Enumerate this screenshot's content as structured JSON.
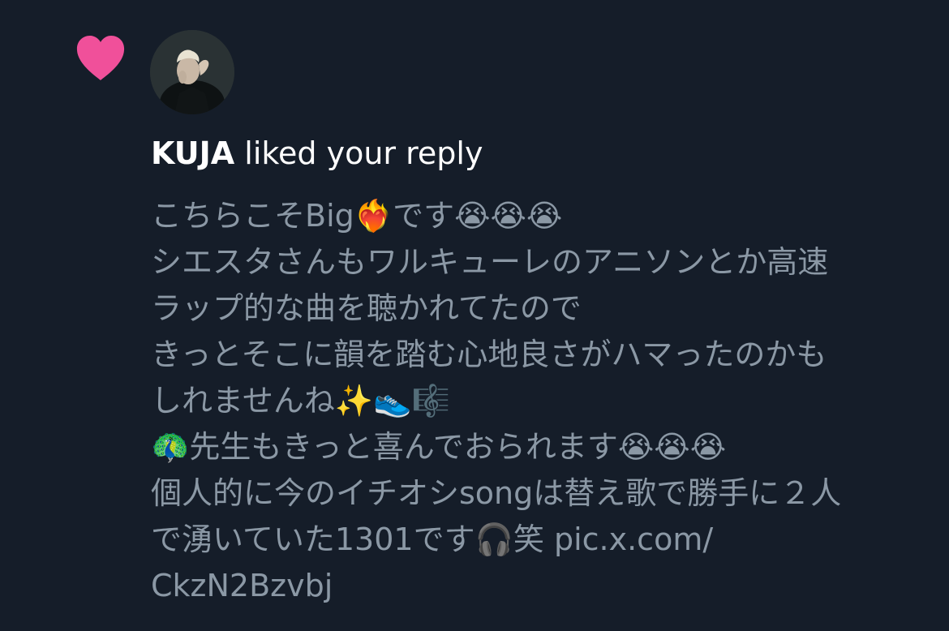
{
  "notification": {
    "username": "KUJA",
    "action_text": " liked your reply",
    "reply_lines": [
      "こちらこそBig❤️‍🔥です😭😭😭",
      "シエスタさんもワルキューレのアニソンとか高速",
      "ラップ的な曲を聴かれてたので",
      "きっとそこに韻を踏む心地良さがハマったのかも",
      "しれませんね✨👟🎼",
      "🦚先生もきっと喜んでおられます😭😭😭",
      "個人的に今のイチオシsongは替え歌で勝手に２人",
      "で湧いていた1301です🎧笑 pic.x.com/",
      "CkzN2Bzvbj"
    ]
  },
  "colors": {
    "background": "#151d29",
    "heart": "#f0509a",
    "primary_text": "#ffffff",
    "secondary_text": "#8b98a5"
  },
  "icons": {
    "like": "heart-icon",
    "avatar": "user-avatar"
  }
}
